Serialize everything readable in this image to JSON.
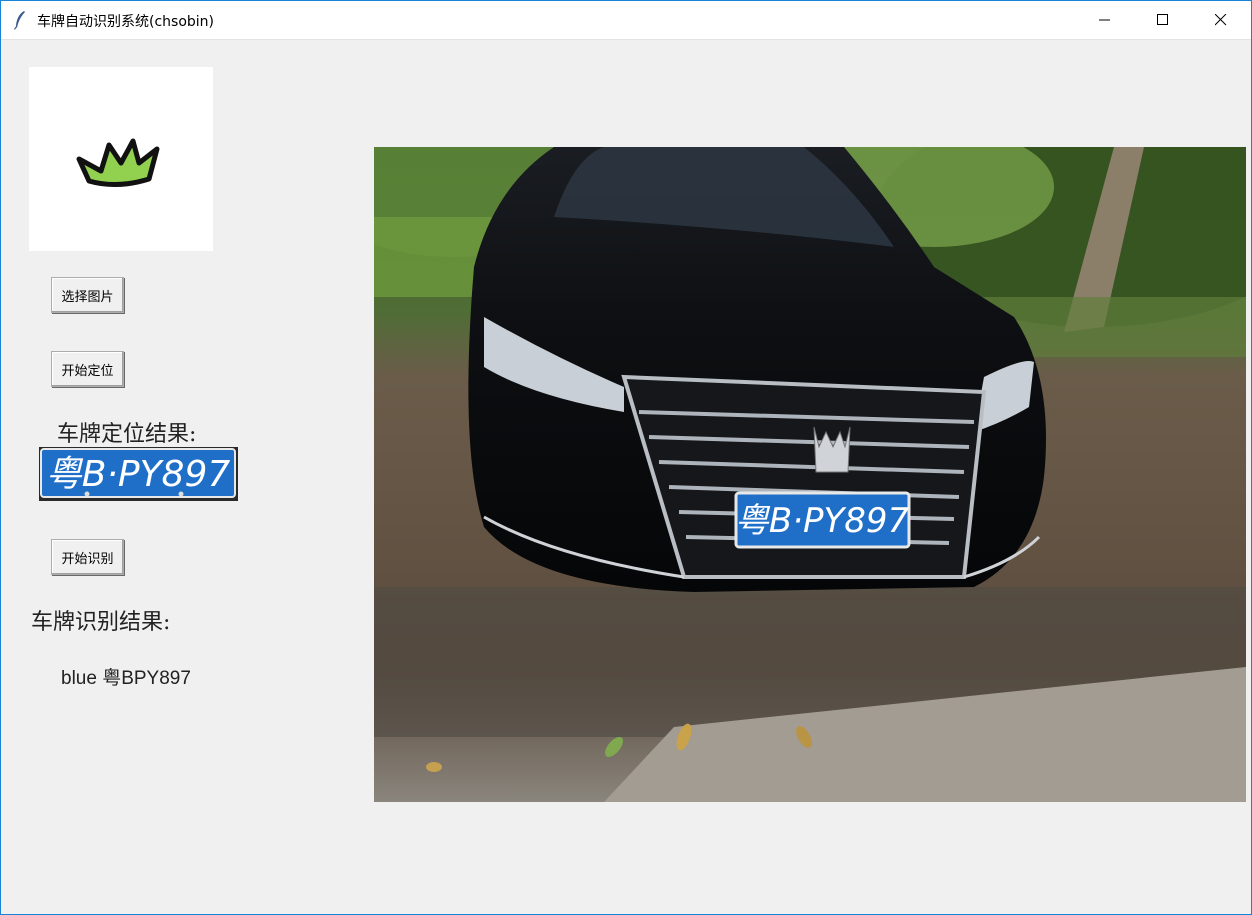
{
  "window": {
    "title": "车牌自动识别系统(chsobin)",
    "minimize_glyph": "—",
    "maximize_glyph": "☐",
    "close_glyph": "✕"
  },
  "logo": {
    "icon": "crown-icon"
  },
  "buttons": {
    "select_image": "选择图片",
    "start_locate": "开始定位",
    "start_recognize": "开始识别"
  },
  "locate": {
    "label": "车牌定位结果:",
    "plate_text": "粤B·PY897"
  },
  "recognize": {
    "label": "车牌识别结果:",
    "result": "blue  粤BPY897"
  },
  "photo": {
    "plate_text": "粤B·PY897"
  },
  "colors": {
    "plate_blue": "#1f6fc9",
    "accent_border": "#1883d7",
    "crown_green": "#92d050"
  }
}
